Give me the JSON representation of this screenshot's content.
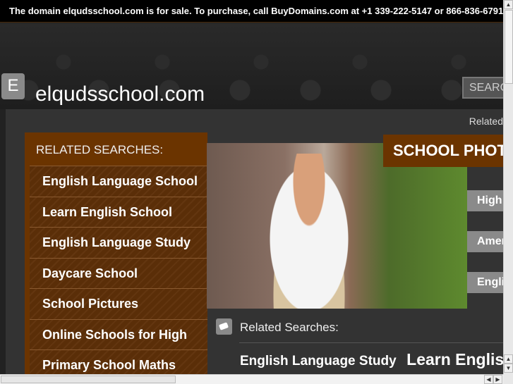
{
  "banner": "The domain elqudsschool.com is for sale. To purchase, call BuyDomains.com at +1 339-222-5147 or 866-836-6791",
  "header": {
    "logo_letter": "E",
    "site_title": "elqudsschool.com",
    "search_label": "SEARCH"
  },
  "main": {
    "related_top": "Related",
    "sidebar": {
      "title": "RELATED SEARCHES:",
      "items": [
        "English Language School",
        "Learn English School",
        "English Language Study",
        "Daycare School",
        "School Pictures",
        "Online Schools for High",
        "Primary School Maths"
      ]
    },
    "photos_title": "SCHOOL PHOTOS",
    "tabs": [
      "High",
      "American",
      "English"
    ],
    "related_label": "Related Searches:",
    "related_links": [
      "English Language Study",
      "Learn English School"
    ]
  }
}
